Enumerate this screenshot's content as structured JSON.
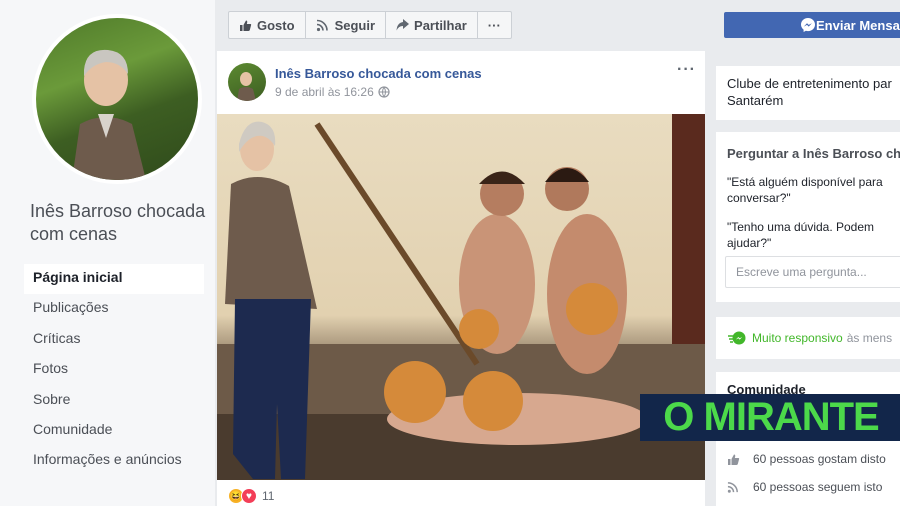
{
  "page": {
    "name": "Inês Barroso chocada com cenas",
    "nav": [
      "Página inicial",
      "Publicações",
      "Críticas",
      "Fotos",
      "Sobre",
      "Comunidade",
      "Informações e anúncios"
    ]
  },
  "actions": {
    "like": "Gosto",
    "follow": "Seguir",
    "share": "Partilhar",
    "more": "···"
  },
  "message_button": "Enviar Mensa",
  "post": {
    "author": "Inês Barroso chocada com cenas",
    "date": "9 de abril às 16:26",
    "more": "···",
    "reaction_count": "11"
  },
  "sidebar": {
    "about": "Clube de entretenimento par Santarém",
    "ask_title": "Perguntar a Inês Barroso cho",
    "question1": "\"Está alguém disponível para conversar?\"",
    "question2": "\"Tenho uma dúvida. Podem ajudar?\"",
    "ask_placeholder": "Escreve uma pergunta...",
    "responsive_label": "Muito responsivo",
    "responsive_suffix": "às mens",
    "community_title": "Comunidade",
    "likes": "60 pessoas gostam disto",
    "follows": "60 pessoas seguem isto"
  },
  "watermark": "O MIRANTE",
  "colors": {
    "facebook_blue": "#4267b2",
    "link_blue": "#365899",
    "logo_bg": "#12264a",
    "logo_text": "#4cd94a",
    "responsive_green": "#42b72a"
  }
}
